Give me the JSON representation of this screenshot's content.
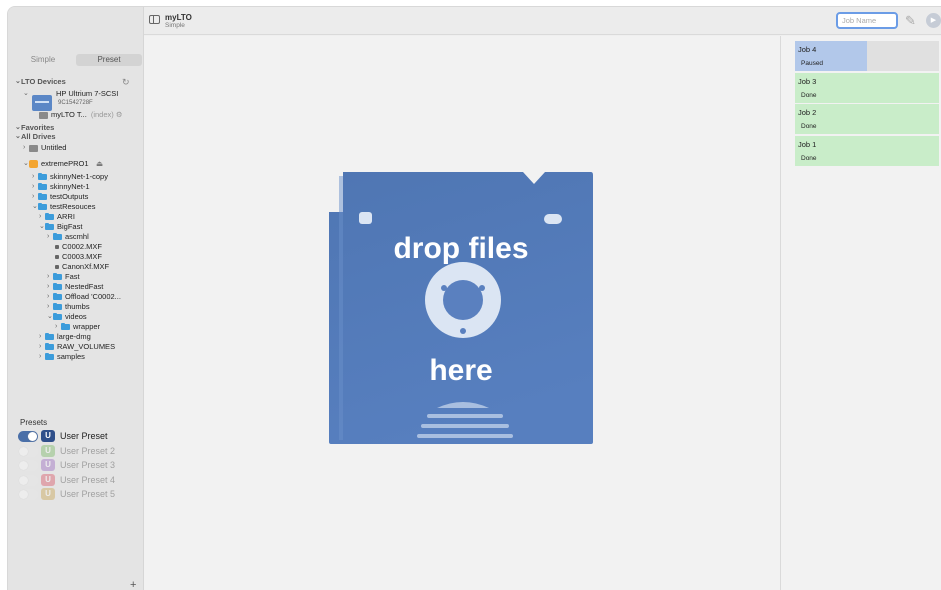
{
  "app": {
    "title": "myLTO",
    "subtitle": "Simple"
  },
  "sidebar": {
    "modes": [
      "Simple",
      "Preset"
    ],
    "selected_mode": "Preset",
    "lto_header": "LTO Devices",
    "device_name": "HP Ultrium 7-SCSI",
    "device_serial": "9C1542728F",
    "tape_name": "myLTO T...",
    "tape_tag": "(index)",
    "favorites": "Favorites",
    "all_drives": "All Drives",
    "drive_untitled": "Untitled",
    "drive_extreme": "extremePRO1",
    "tree": [
      "skinnyNet-1-copy",
      "skinnyNet-1",
      "testOutputs",
      "testResouces",
      "ARRI",
      "BigFast",
      "ascmhl",
      "C0002.MXF",
      "C0003.MXF",
      "CanonXf.MXF",
      "Fast",
      "NestedFast",
      "Offload 'C0002...",
      "thumbs",
      "videos",
      "wrapper",
      "large-dmg",
      "RAW_VOLUMES",
      "samples"
    ],
    "presets_title": "Presets",
    "presets": [
      {
        "badge": "U",
        "label": "User Preset",
        "color": "#2f4f8a",
        "enabled": true
      },
      {
        "badge": "U",
        "label": "User Preset 2",
        "color": "#62b04a",
        "enabled": false
      },
      {
        "badge": "U",
        "label": "User Preset 3",
        "color": "#8a4fb8",
        "enabled": false
      },
      {
        "badge": "U",
        "label": "User Preset 4",
        "color": "#d8344a",
        "enabled": false
      },
      {
        "badge": "U",
        "label": "User Preset 5",
        "color": "#c2952e",
        "enabled": false
      }
    ],
    "add_label": "+"
  },
  "toolbar": {
    "job_name_placeholder": "Job Name"
  },
  "dropzone": {
    "line1": "drop files",
    "line2": "here"
  },
  "jobs": [
    {
      "name": "Job 4",
      "status": "Paused",
      "progress": 0.5
    },
    {
      "name": "Job 3",
      "status": "Done"
    },
    {
      "name": "Job 2",
      "status": "Done"
    },
    {
      "name": "Job 1",
      "status": "Done"
    }
  ]
}
